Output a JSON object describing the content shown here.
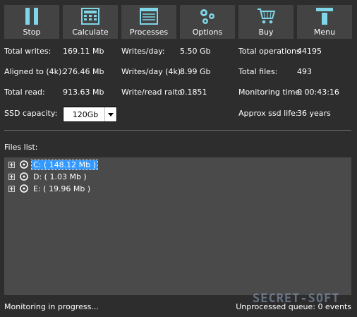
{
  "toolbar": {
    "buttons": [
      {
        "label": "Stop",
        "icon": "pause-icon"
      },
      {
        "label": "Calculate",
        "icon": "calculator-icon"
      },
      {
        "label": "Processes",
        "icon": "list-window-icon"
      },
      {
        "label": "Options",
        "icon": "gears-icon"
      },
      {
        "label": "Buy",
        "icon": "cart-icon"
      },
      {
        "label": "Menu",
        "icon": "menu-icon"
      }
    ],
    "accent_color": "#7fd6e6"
  },
  "stats": {
    "total_writes_label": "Total writes:",
    "total_writes_value": "169.11 Mb",
    "aligned_label": "Aligned to (4k):",
    "aligned_value": "276.46 Mb",
    "total_read_label": "Total read:",
    "total_read_value": "913.63 Mb",
    "writes_day_label": "Writes/day:",
    "writes_day_value": "5.50 Gb",
    "writes_day_4k_label": "Writes/day (4k):",
    "writes_day_4k_value": "8.99 Gb",
    "write_read_label": "Write/read raito",
    "write_read_value": "0.1851",
    "total_ops_label": "Total operations",
    "total_ops_value": "44195",
    "total_files_label": "Total files:",
    "total_files_value": "493",
    "monitoring_time_label": "Monitoring time:",
    "monitoring_time_value": "0 00:43:16",
    "ssd_capacity_label": "SSD capacity:",
    "ssd_capacity_value": "120Gb",
    "ssd_life_label": "Approx ssd life:",
    "ssd_life_value": "36 years"
  },
  "files": {
    "label": "Files list:",
    "items": [
      {
        "text": "C: ( 148.12 Mb )",
        "selected": true
      },
      {
        "text": "D: ( 1.03 Mb )",
        "selected": false
      },
      {
        "text": "E: ( 19.96 Mb )",
        "selected": false
      }
    ]
  },
  "status": {
    "left": "Monitoring in progress...",
    "right": "Unprocessed queue: 0 events"
  },
  "watermark": "SECRET-SOFT"
}
